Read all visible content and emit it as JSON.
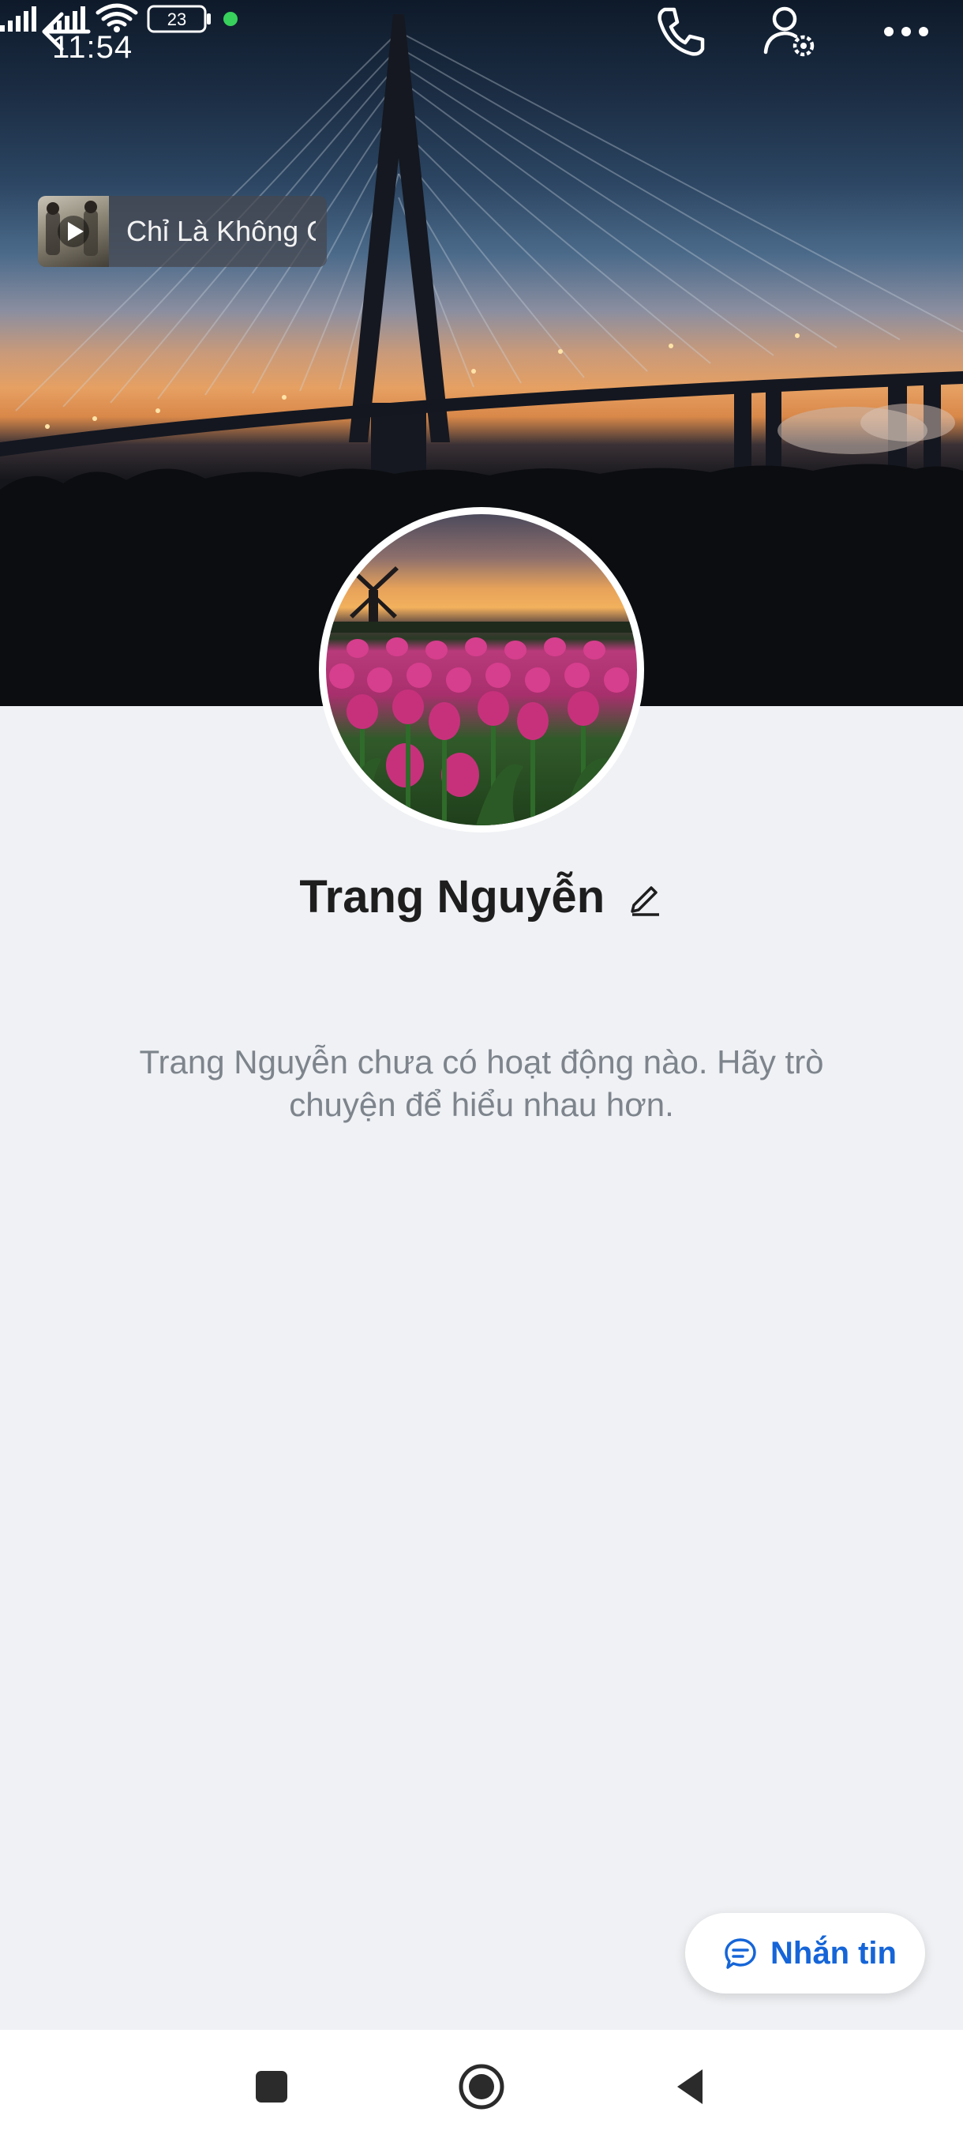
{
  "status_bar": {
    "time": "11:54",
    "battery": "23",
    "icons": [
      "signal-icon",
      "signal-icon-2",
      "wifi-icon",
      "battery-icon",
      "active-dot"
    ]
  },
  "header": {
    "back_icon": "arrow-left-icon",
    "call_icon": "phone-icon",
    "settings_icon": "user-settings-icon",
    "more_icon": "more-dots-icon"
  },
  "music": {
    "title": "Chỉ Là Không Cùng Nhau",
    "play_icon": "play-icon"
  },
  "profile": {
    "name": "Trang Nguyễn",
    "edit_icon": "pencil-icon",
    "empty_message": "Trang Nguyễn chưa có hoạt động nào. Hãy trò chuyện để hiểu nhau hơn."
  },
  "actions": {
    "message_label": "Nhắn tin",
    "message_icon": "chat-bubble-icon",
    "accent_color": "#1565d8"
  },
  "navbar": {
    "items": [
      "recents-square-icon",
      "home-circle-icon",
      "back-triangle-icon"
    ]
  }
}
